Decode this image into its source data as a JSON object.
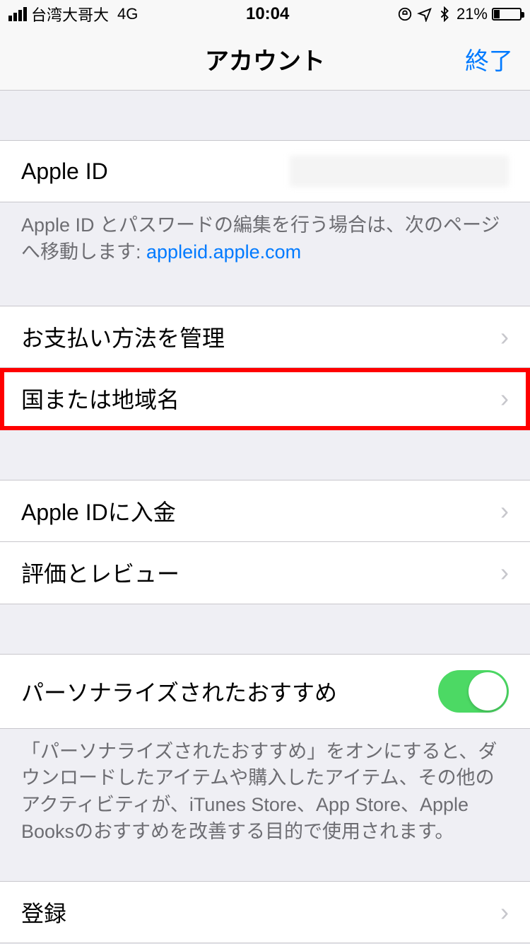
{
  "status": {
    "carrier": "台湾大哥大",
    "network": "4G",
    "time": "10:04",
    "battery_pct": "21%"
  },
  "nav": {
    "title": "アカウント",
    "done": "終了"
  },
  "appleid": {
    "label": "Apple ID",
    "footer_prefix": "Apple ID とパスワードの編集を行う場合は、次のページへ移動します: ",
    "footer_link": "appleid.apple.com"
  },
  "rows": {
    "payment": "お支払い方法を管理",
    "country": "国または地域名",
    "add_funds": "Apple IDに入金",
    "ratings": "評価とレビュー",
    "personalized": "パーソナライズされたおすすめ",
    "personalized_footer": "「パーソナライズされたおすすめ」をオンにすると、ダウンロードしたアイテムや購入したアイテム、その他のアクティビティが、iTunes Store、App Store、Apple Booksのおすすめを改善する目的で使用されます。",
    "subscriptions": "登録"
  }
}
